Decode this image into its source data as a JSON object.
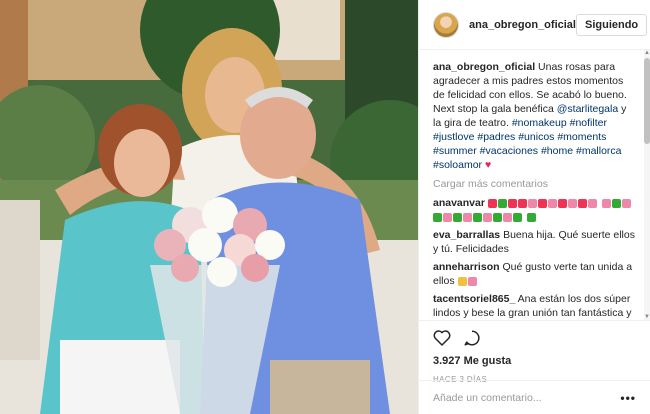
{
  "post": {
    "username": "ana_obregon_oficial",
    "follow_label": "Siguiendo",
    "caption_user": "ana_obregon_oficial",
    "caption_text": "Unas rosas para agradecer a mis padres estos momentos de felicidad con ellos. Se acabó lo bueno. Next stop la gala benéfica",
    "mention": "@starlitegala",
    "caption_text2": "y la gira de teatro.",
    "hashtags": "#nomakeup #nofilter #justlove #padres #unicos #moments #summer #vacaciones #home #mallorca #soloamor",
    "load_more": "Cargar más comentarios",
    "likes": "3.927 Me gusta",
    "time_ago": "HACE 3 DÍAS",
    "comment_placeholder": "Añade un comentario...",
    "more_options": "•••"
  },
  "comments": [
    {
      "user": "anavanvar",
      "text": ""
    },
    {
      "user": "eva_barrallas",
      "text": "Buena hija. Qué suerte ellos y tú. Felicidades"
    },
    {
      "user": "anneharrison",
      "text": "Qué gusto verte tan unida a ellos"
    },
    {
      "user": "tacentsoriel865_",
      "text": "Ana están los dos súper lindos y bese la gran unión tan fantástica y la felicidad de ellos eras vacaciones aunque"
    }
  ],
  "colors": {
    "link": "#003569",
    "muted": "#999999",
    "text": "#262626"
  },
  "icons": [
    "heart-icon",
    "comment-icon",
    "more-options-icon",
    "user-avatar"
  ]
}
